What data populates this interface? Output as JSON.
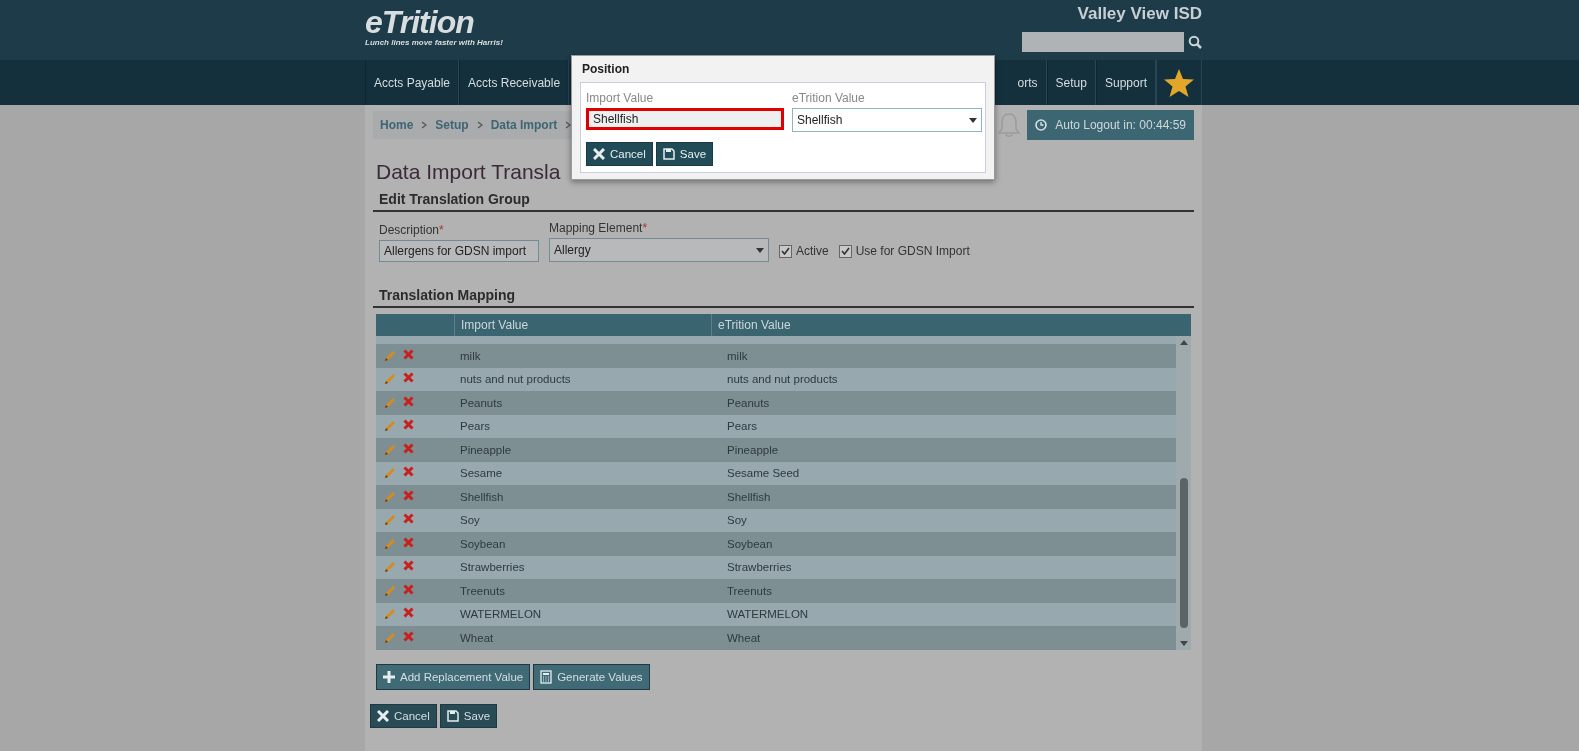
{
  "header": {
    "logo": "eTrition",
    "tagline": "Lunch lines move faster with Harris!",
    "district": "Valley View ISD",
    "nav": [
      {
        "label": "Accts Payable"
      },
      {
        "label": "Accts Receivable"
      },
      {
        "label": "orts"
      },
      {
        "label": "Setup"
      },
      {
        "label": "Support"
      }
    ]
  },
  "breadcrumb": [
    "Home",
    "Setup",
    "Data Import"
  ],
  "auto_logout": "Auto Logout in: 00:44:59",
  "page_title": "Data Import Transla",
  "edit_section": {
    "title": "Edit Translation Group",
    "description": {
      "label": "Description",
      "required_mark": "*",
      "value": "Allergens for GDSN import"
    },
    "mapping_element": {
      "label": "Mapping Element",
      "required_mark": "*",
      "value": "Allergy"
    },
    "checkboxes": [
      {
        "label": "Active",
        "checked": true
      },
      {
        "label": "Use for GDSN Import",
        "checked": true
      }
    ]
  },
  "mapping_section": {
    "title": "Translation Mapping",
    "table": {
      "columns": [
        "Import Value",
        "eTrition Value"
      ],
      "rows": [
        {
          "import_value": "milk",
          "etrition_value": "milk"
        },
        {
          "import_value": "nuts and nut products",
          "etrition_value": "nuts and nut products"
        },
        {
          "import_value": "Peanuts",
          "etrition_value": "Peanuts"
        },
        {
          "import_value": "Pears",
          "etrition_value": "Pears"
        },
        {
          "import_value": "Pineapple",
          "etrition_value": "Pineapple"
        },
        {
          "import_value": "Sesame",
          "etrition_value": "Sesame Seed"
        },
        {
          "import_value": "Shellfish",
          "etrition_value": "Shellfish"
        },
        {
          "import_value": "Soy",
          "etrition_value": "Soy"
        },
        {
          "import_value": "Soybean",
          "etrition_value": "Soybean"
        },
        {
          "import_value": "Strawberries",
          "etrition_value": "Strawberries"
        },
        {
          "import_value": "Treenuts",
          "etrition_value": "Treenuts"
        },
        {
          "import_value": "WATERMELON",
          "etrition_value": "WATERMELON"
        },
        {
          "import_value": "Wheat",
          "etrition_value": "Wheat"
        }
      ]
    },
    "buttons": [
      {
        "kind": "add",
        "label": "Add Replacement Value"
      },
      {
        "kind": "generate",
        "label": "Generate Values"
      }
    ]
  },
  "footer_buttons": [
    {
      "kind": "cancel",
      "label": "Cancel"
    },
    {
      "kind": "save",
      "label": "Save"
    }
  ],
  "dialog": {
    "title": "Position",
    "import_value": {
      "label": "Import Value",
      "value": "Shellfish",
      "highlighted": true
    },
    "etrition_value": {
      "label": "eTrition Value",
      "value": "Shellfish"
    },
    "buttons": [
      {
        "kind": "cancel",
        "label": "Cancel"
      },
      {
        "kind": "save",
        "label": "Save"
      }
    ]
  }
}
